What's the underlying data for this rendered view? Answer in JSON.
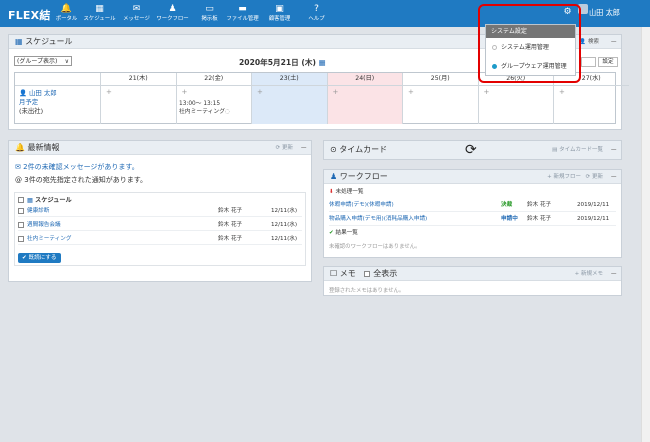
{
  "app": {
    "logo": "FLEX結",
    "user_name": "山田 太郎"
  },
  "nav": [
    {
      "label": "ポータル",
      "icon": "bell-icon",
      "glyph": "🔔"
    },
    {
      "label": "スケジュール",
      "icon": "calendar-icon",
      "glyph": "▦"
    },
    {
      "label": "メッセージ",
      "icon": "mail-icon",
      "glyph": "✉"
    },
    {
      "label": "ワークフロー",
      "icon": "workflow-icon",
      "glyph": "♟"
    },
    {
      "label": "掲示板",
      "icon": "board-icon",
      "glyph": "▭"
    },
    {
      "label": "ファイル管理",
      "icon": "folder-icon",
      "glyph": "▬"
    },
    {
      "label": "顧客管理",
      "icon": "customer-icon",
      "glyph": "▣"
    },
    {
      "label": "ヘルプ",
      "icon": "help-icon",
      "glyph": "?"
    }
  ],
  "dropdown": {
    "title": "システム設定",
    "items": [
      "システム運用管理",
      "グループウェア運用管理"
    ]
  },
  "schedule": {
    "title": "スケジュール",
    "search": "検索",
    "group_select": "(グループ表示)",
    "date": "2020年5月21日 (木)",
    "settings": "設定",
    "days": [
      "21(木)",
      "22(金)",
      "23(土)",
      "24(日)",
      "25(月)",
      "26(火)",
      "27(水)"
    ],
    "person": {
      "name": "山田 太郎",
      "plan": "月予定",
      "status": "(未出社)"
    },
    "event": {
      "time": "13:00～ 13:15",
      "title": "社内ミーティング"
    }
  },
  "news": {
    "title": "最新情報",
    "refresh": "更新",
    "unread": "2件の未確認メッセージがあります。",
    "notice": "3件の宛先指定された通知があります。",
    "section": "スケジュール",
    "rows": [
      {
        "title": "健康診断",
        "person": "鈴木 花子",
        "date": "12/11(水)"
      },
      {
        "title": "週間報告会議",
        "person": "鈴木 花子",
        "date": "12/11(水)"
      },
      {
        "title": "社内ミーティング",
        "person": "鈴木 花子",
        "date": "12/11(水)"
      }
    ],
    "confirm_button": "既読にする"
  },
  "timecard": {
    "title": "タイムカード",
    "list": "タイムカード一覧"
  },
  "workflow": {
    "title": "ワークフロー",
    "new": "新規フロー",
    "refresh": "更新",
    "pending": "未処理一覧",
    "rows": [
      {
        "title": "休暇申請(デモ)(休暇申請)",
        "status": "決裁",
        "person": "鈴木 花子",
        "date": "2019/12/11"
      },
      {
        "title": "物品購入申請(デモ用)(消耗品購入申請)",
        "status": "申請中",
        "person": "鈴木 花子",
        "date": "2019/12/11"
      }
    ],
    "result": "結果一覧",
    "empty": "未確認のワークフローはありません。"
  },
  "memo": {
    "title": "メモ",
    "show_all": "全表示",
    "new": "新規メモ",
    "empty": "登録されたメモはありません。"
  },
  "colors": {
    "header": "#1f7ac2",
    "saturday": "#dce9f8",
    "sunday": "#fbe3e6",
    "approved": "#2a9a2a",
    "applying": "#1f69b4",
    "highlight": "#e30000"
  }
}
